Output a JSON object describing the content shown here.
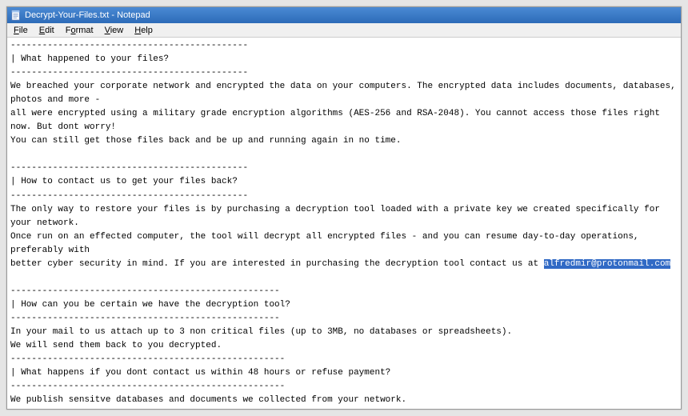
{
  "window": {
    "title": "Decrypt-Your-Files.txt - Notepad"
  },
  "menu": {
    "file": "File",
    "edit": "Edit",
    "format": "Format",
    "view": "View",
    "help": "Help"
  },
  "content": {
    "sep1": "---------------------------------------------",
    "q1": "| What happened to your files?",
    "sep2": "---------------------------------------------",
    "p1a": "We breached your corporate network and encrypted the data on your computers. The encrypted data includes documents, databases, photos and more -",
    "p1b": "all were encrypted using a military grade encryption algorithms (AES-256 and RSA-2048). You cannot access those files right now. But dont worry!",
    "p1c": "You can still get those files back and be up and running again in no time.",
    "sep3": "---------------------------------------------",
    "q2": "| How to contact us to get your files back?",
    "sep4": "---------------------------------------------",
    "p2a": "The only way to restore your files is by purchasing a decryption tool loaded with a private key we created specifically for your network.",
    "p2b": "Once run on an effected computer, the tool will decrypt all encrypted files - and you can resume day-to-day operations, preferably with",
    "p2c_pre": "better cyber security in mind. If you are interested in purchasing the decryption tool contact us at ",
    "p2c_email": "alfredmir@protonmail.com",
    "sep5": "---------------------------------------------------",
    "q3": "| How can you be certain we have the decryption tool?",
    "sep6": "---------------------------------------------------",
    "p3a": "In your mail to us attach up to 3 non critical files (up to 3MB, no databases or spreadsheets).",
    "p3b": "We will send them back to you decrypted.",
    "sep7": "----------------------------------------------------",
    "q4": "| What happens if you dont contact us within 48 hours or refuse payment?",
    "sep8": "----------------------------------------------------",
    "p4a": "We publish sensitve databases and documents we collected from your network.",
    "sep9": "----------------------------------------------------"
  }
}
